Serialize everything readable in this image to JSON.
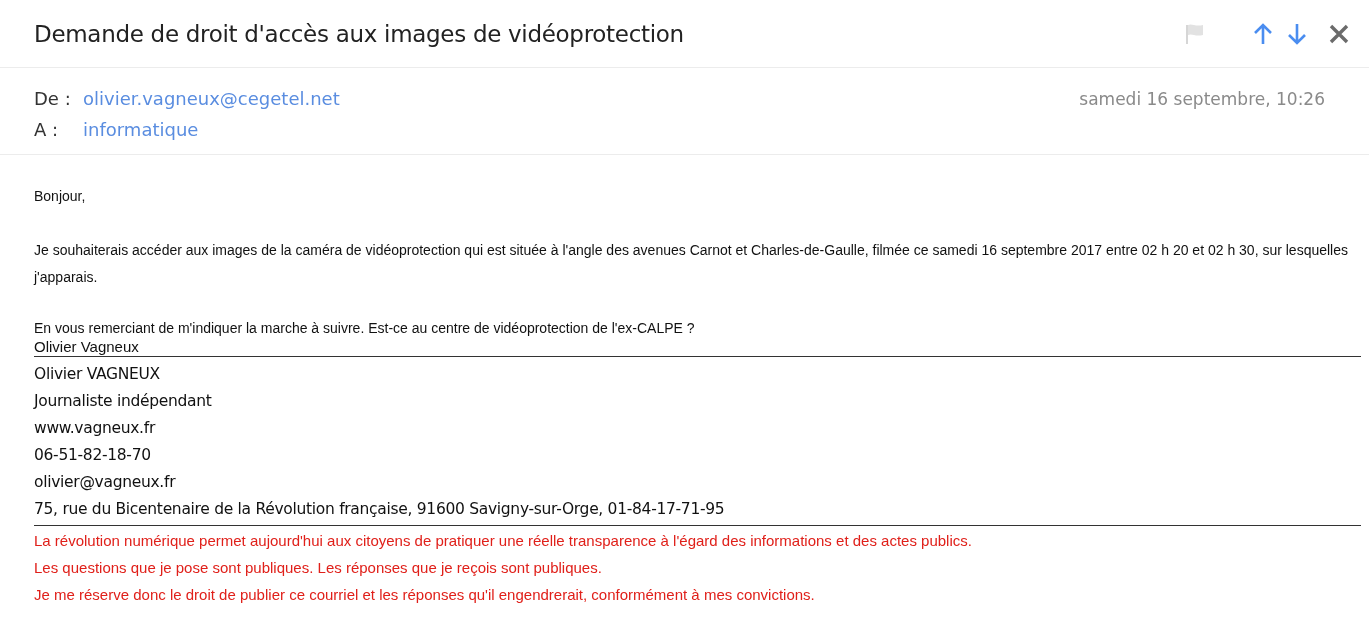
{
  "message": {
    "subject": "Demande de droit d'accès aux images de vidéoprotection",
    "flagged": false
  },
  "header": {
    "from_label": "De :",
    "from": "olivier.vagneux@cegetel.net",
    "to_label": "A :",
    "to": "informatique",
    "date": "samedi 16 septembre, 10:26"
  },
  "body": {
    "paragraphs": [
      "Bonjour,",
      "Je souhaiterais accéder aux images de la caméra de vidéoprotection qui est située à l'angle des avenues Carnot et Charles-de-Gaulle, filmée ce samedi 16 septembre 2017 entre 02 h 20 et 02 h 30, sur lesquelles j'apparais.",
      "En vous remerciant de m'indiquer la marche à suivre. Est-ce au centre de vidéoprotection de l'ex-CALPE ?"
    ],
    "sign_off": "Olivier Vagneux"
  },
  "signature": {
    "lines": [
      "Olivier VAGNEUX",
      "Journaliste indépendant",
      "www.vagneux.fr",
      "06-51-82-18-70",
      "olivier@vagneux.fr",
      "75, rue du Bicentenaire de la Révolution française, 91600 Savigny-sur-Orge, 01-84-17-71-95"
    ],
    "notice": [
      "La révolution numérique permet aujourd'hui aux citoyens de pratiquer une réelle transparence à l'égard des informations et des actes publics.",
      "Les questions que je pose sont publiques. Les réponses que je reçois sont publiques.",
      "Je me réserve donc le droit de publier ce courriel et les réponses qu'il engendrerait, conformément à mes convictions."
    ]
  }
}
